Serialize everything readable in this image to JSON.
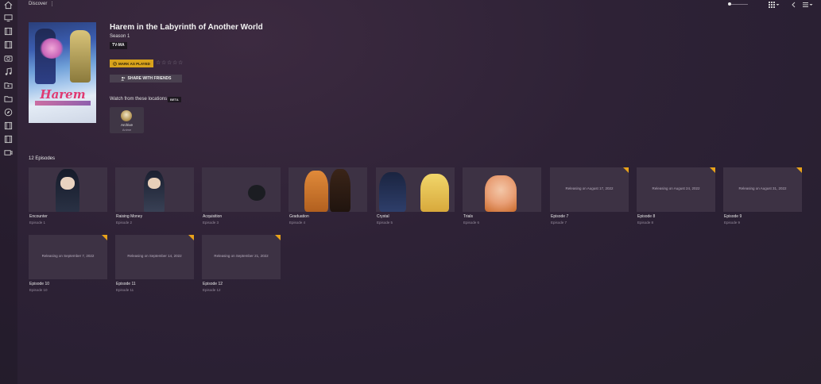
{
  "topbar": {
    "title": "Discover",
    "more_icon": "vertical-dots-icon",
    "icons": [
      "grid-view-icon",
      "chevron-down-icon",
      "back-icon",
      "list-menu-icon",
      "chevron-down-icon"
    ]
  },
  "sidebar": {
    "icons": [
      "home-icon",
      "monitor-icon",
      "film-icon",
      "film-icon",
      "camera-icon",
      "music-icon",
      "video-folder-icon",
      "folder-icon",
      "compass-icon",
      "film-icon",
      "film-icon",
      "playlist-icon"
    ]
  },
  "show": {
    "title": "Harem in the Labyrinth of Another World",
    "season": "Season 1",
    "rating": "TV-MA",
    "poster_logo": "Harem"
  },
  "actions": {
    "mark_played": "MARK AS PLAYED",
    "share": "SHARE WITH FRIENDS",
    "stars": [
      "☆",
      "☆",
      "☆",
      "☆",
      "☆"
    ]
  },
  "locations": {
    "label": "Watch from these locations",
    "badge": "BETA",
    "items": [
      {
        "name": "Archive",
        "sub": "Anime"
      }
    ]
  },
  "episodes": {
    "heading": "12 Episodes",
    "items": [
      {
        "title": "Encounter",
        "number": "Episode 1",
        "release": ""
      },
      {
        "title": "Raising Money",
        "number": "Episode 2",
        "release": ""
      },
      {
        "title": "Acquisition",
        "number": "Episode 3",
        "release": ""
      },
      {
        "title": "Graduation",
        "number": "Episode 4",
        "release": ""
      },
      {
        "title": "Crystal",
        "number": "Episode 5",
        "release": ""
      },
      {
        "title": "Trials",
        "number": "Episode 6",
        "release": ""
      },
      {
        "title": "Episode 7",
        "number": "Episode 7",
        "release": "Releasing on August 17, 2022"
      },
      {
        "title": "Episode 8",
        "number": "Episode 8",
        "release": "Releasing on August 24, 2022"
      },
      {
        "title": "Episode 9",
        "number": "Episode 9",
        "release": "Releasing on August 31, 2022"
      },
      {
        "title": "Episode 10",
        "number": "Episode 10",
        "release": "Releasing on September 7, 2022"
      },
      {
        "title": "Episode 11",
        "number": "Episode 11",
        "release": "Releasing on September 14, 2022"
      },
      {
        "title": "Episode 12",
        "number": "Episode 12",
        "release": "Releasing on September 21, 2022"
      }
    ]
  },
  "colors": {
    "accent": "#d8a31c",
    "corner": "#e8a21a",
    "background": "#2e2236"
  }
}
